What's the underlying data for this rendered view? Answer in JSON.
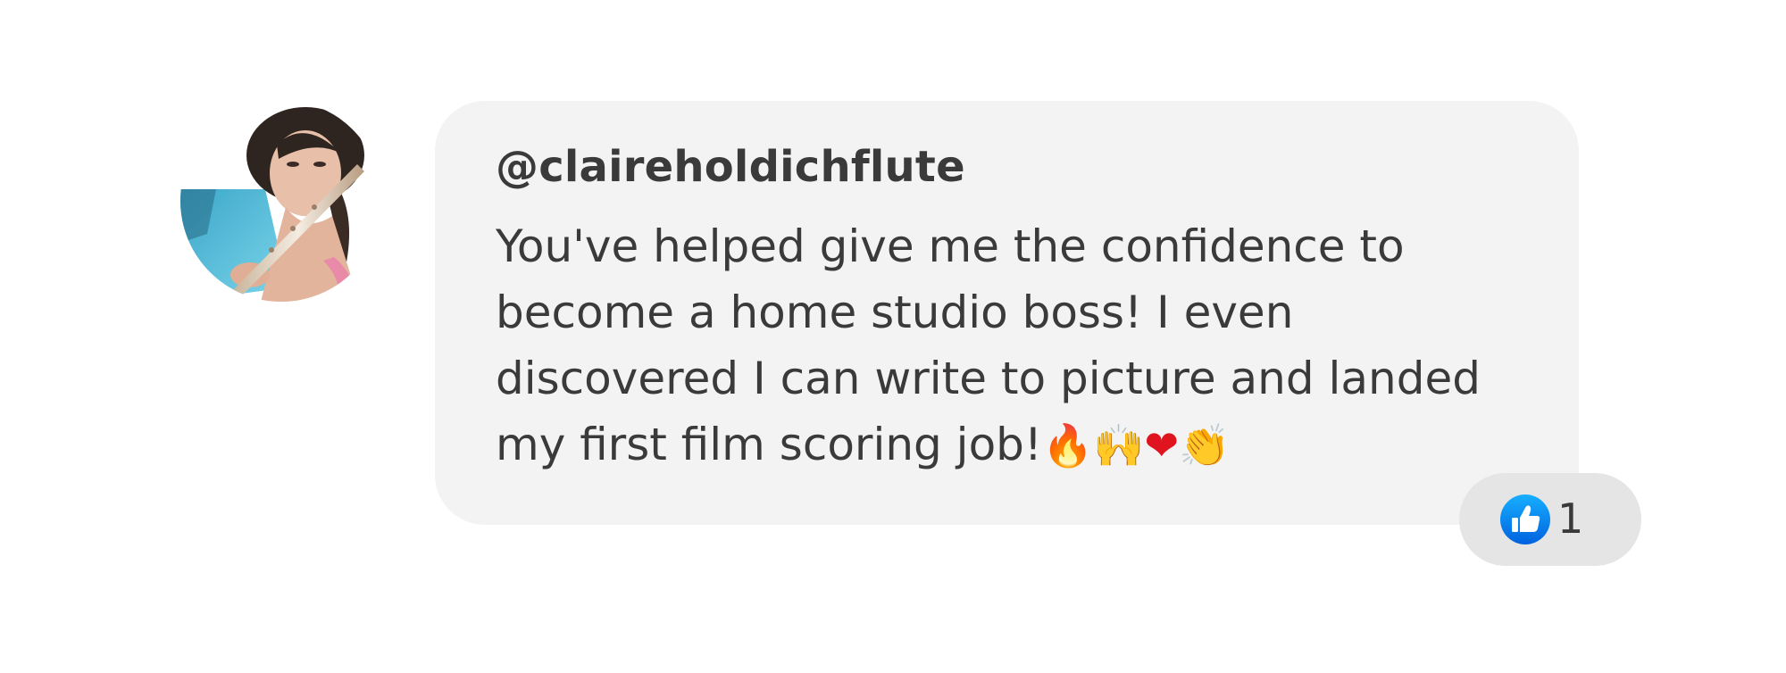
{
  "comment": {
    "username": "@claireholdichflute",
    "text": "You've helped give me the confidence to become a home studio boss! I even discovered I can write to picture and landed my first film scoring job!",
    "emojis": [
      {
        "name": "fire-emoji",
        "char": "🔥",
        "color": "#f05a1a"
      },
      {
        "name": "raised-hands-emoji",
        "char": "🙌",
        "color": "#f3c02a"
      },
      {
        "name": "heart-emoji",
        "char": "❤",
        "color": "#e0141e"
      },
      {
        "name": "clapping-hands-emoji",
        "char": "👏",
        "color": "#f3b72a"
      }
    ],
    "reactions": {
      "icon": "thumbs-up-icon",
      "count": "1",
      "accent": "#1877f2"
    }
  },
  "colors": {
    "bubble_bg": "#f3f3f3",
    "reaction_bg": "#e5e5e5",
    "text": "#3a3a3a"
  }
}
